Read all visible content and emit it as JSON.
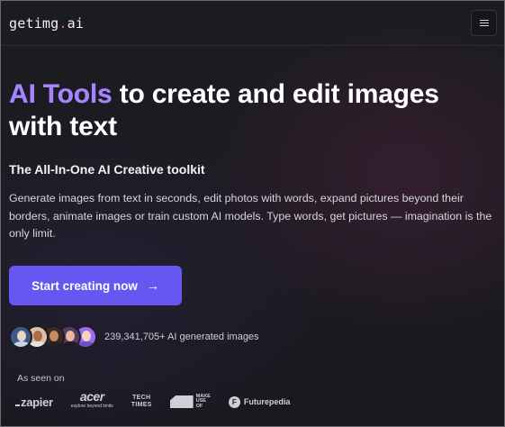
{
  "header": {
    "logo_main": "getimg",
    "logo_dot": ".",
    "logo_tld": "ai",
    "menu_icon": "hamburger-menu-icon"
  },
  "hero": {
    "title_accent": "AI Tools",
    "title_rest": " to create and edit images with text",
    "subtitle": "The All-In-One AI Creative toolkit",
    "description": "Generate images from text in seconds, edit photos with words, expand pictures beyond their borders, animate images or train custom AI models. Type words, get pictures — imagination is the only limit.",
    "cta_label": "Start creating now",
    "cta_icon": "arrow-right-icon"
  },
  "social_proof": {
    "count_text": "239,341,705+ AI generated images",
    "avatars": [
      {
        "bg": "#3b5a8a",
        "face": "#e9d6c6",
        "body": "#c9d3e6"
      },
      {
        "bg": "#d8c1a7",
        "face": "#b06a4a",
        "body": "#e8e2da"
      },
      {
        "bg": "#3a2b26",
        "face": "#c78b64",
        "body": "#262022"
      },
      {
        "bg": "#4d3f66",
        "face": "#f0b59a",
        "body": "#1e1b26"
      },
      {
        "bg": "#9a6cf0",
        "face": "#f3d3c0",
        "body": "#6b4fc4"
      }
    ]
  },
  "as_seen_on": {
    "label": "As seen on",
    "zapier": "zapier",
    "acer": "acer",
    "acer_tag": "explore beyond limits",
    "techtimes_1": "TECH",
    "techtimes_2": "TIMES",
    "muo_1": "MAKE",
    "muo_2": "USE",
    "muo_3": "OF",
    "futurepedia_icon": "F",
    "futurepedia": "Futurepedia"
  },
  "colors": {
    "accent": "#a684ff",
    "cta": "#6656f2",
    "background": "#1b1b20"
  }
}
